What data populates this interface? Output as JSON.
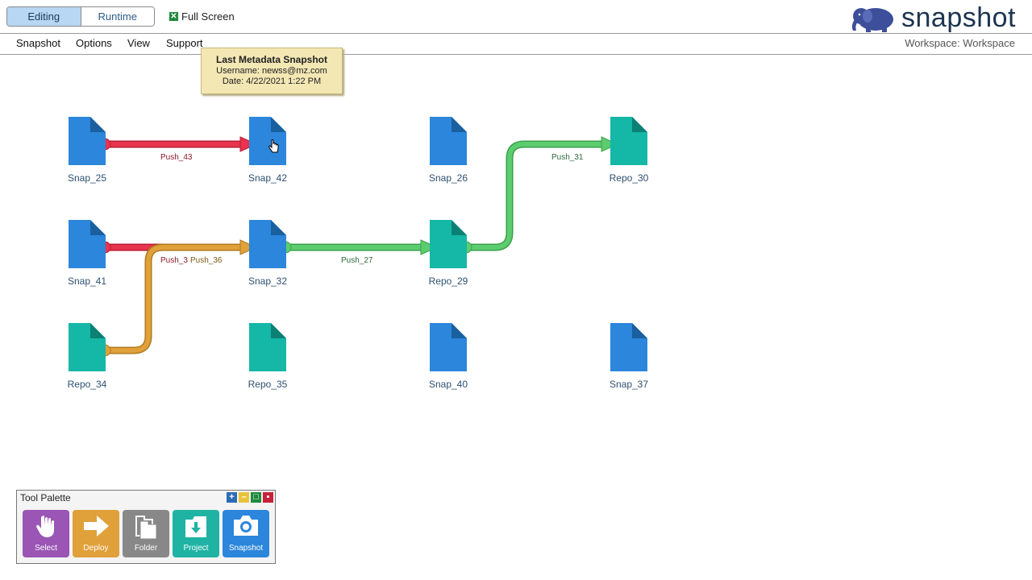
{
  "header": {
    "mode_editing": "Editing",
    "mode_runtime": "Runtime",
    "fullscreen_label": "Full Screen",
    "fullscreen_checked": true,
    "logo_text": "snapshot"
  },
  "menu": {
    "items": [
      "Snapshot",
      "Options",
      "View",
      "Support"
    ],
    "workspace": "Workspace: Workspace"
  },
  "tooltip": {
    "title": "Last Metadata Snapshot",
    "username": "Username: newss@mz.com",
    "date": "Date: 4/22/2021 1:22 PM"
  },
  "nodes": [
    {
      "name": "Snap_25",
      "kind": "snap"
    },
    {
      "name": "Snap_42",
      "kind": "snap"
    },
    {
      "name": "Snap_26",
      "kind": "snap"
    },
    {
      "name": "Repo_30",
      "kind": "repo"
    },
    {
      "name": "Snap_41",
      "kind": "snap"
    },
    {
      "name": "Snap_32",
      "kind": "snap"
    },
    {
      "name": "Repo_29",
      "kind": "repo"
    },
    {
      "name": "Repo_34",
      "kind": "repo"
    },
    {
      "name": "Repo_35",
      "kind": "repo"
    },
    {
      "name": "Snap_40",
      "kind": "snap"
    },
    {
      "name": "Snap_37",
      "kind": "snap"
    }
  ],
  "connections": [
    {
      "label": "Push_43",
      "color": "#e8344e",
      "label_color": "#8a1a2a"
    },
    {
      "label": "Push_3",
      "color": "#e8344e",
      "label_color": "#8a1a2a"
    },
    {
      "label": "Push_36",
      "color": "#e0a03a",
      "label_color": "#7a5a10"
    },
    {
      "label": "Push_27",
      "color": "#5ccd6e",
      "label_color": "#2e6b3a"
    },
    {
      "label": "Push_31",
      "color": "#5ccd6e",
      "label_color": "#2e6b3a"
    }
  ],
  "colors": {
    "snap": "#2b86dc",
    "snap_fold": "#1a5f9e",
    "repo": "#15b7a7",
    "repo_fold": "#0c8074"
  },
  "palette": {
    "title": "Tool Palette",
    "tools": [
      {
        "label": "Select",
        "icon": "hand-icon",
        "color": "#9a55b5"
      },
      {
        "label": "Deploy",
        "icon": "arrow-right-icon",
        "color": "#e0a03a"
      },
      {
        "label": "Folder",
        "icon": "folder-icon",
        "color": "#888888"
      },
      {
        "label": "Project",
        "icon": "download-icon",
        "color": "#1fb3a3"
      },
      {
        "label": "Snapshot",
        "icon": "camera-icon",
        "color": "#2b86dc"
      }
    ]
  }
}
